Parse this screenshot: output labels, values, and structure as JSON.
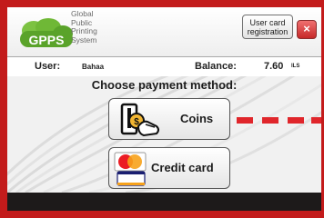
{
  "logo": {
    "brand": "GPPS",
    "lines": [
      "Global",
      "Public",
      "Printing",
      "System"
    ]
  },
  "header": {
    "user_card_line1": "User card",
    "user_card_line2": "registration",
    "close_symbol": "×"
  },
  "info": {
    "user_label": "User:",
    "user_name": "Bahaa",
    "balance_label": "Balance:",
    "balance_value": "7.60",
    "currency": "ILS"
  },
  "payment": {
    "title": "Choose payment method:",
    "coins_label": "Coins",
    "credit_label": "Credit card",
    "coins_icon": "hand-inserting-coin-icon",
    "credit_icon": "credit-cards-icon",
    "card_brands": [
      "MasterCard",
      "VISA"
    ]
  },
  "colors": {
    "frame": "#c31b1b",
    "accent_dash": "#e0262b",
    "logo_green": "#5aa32a"
  }
}
